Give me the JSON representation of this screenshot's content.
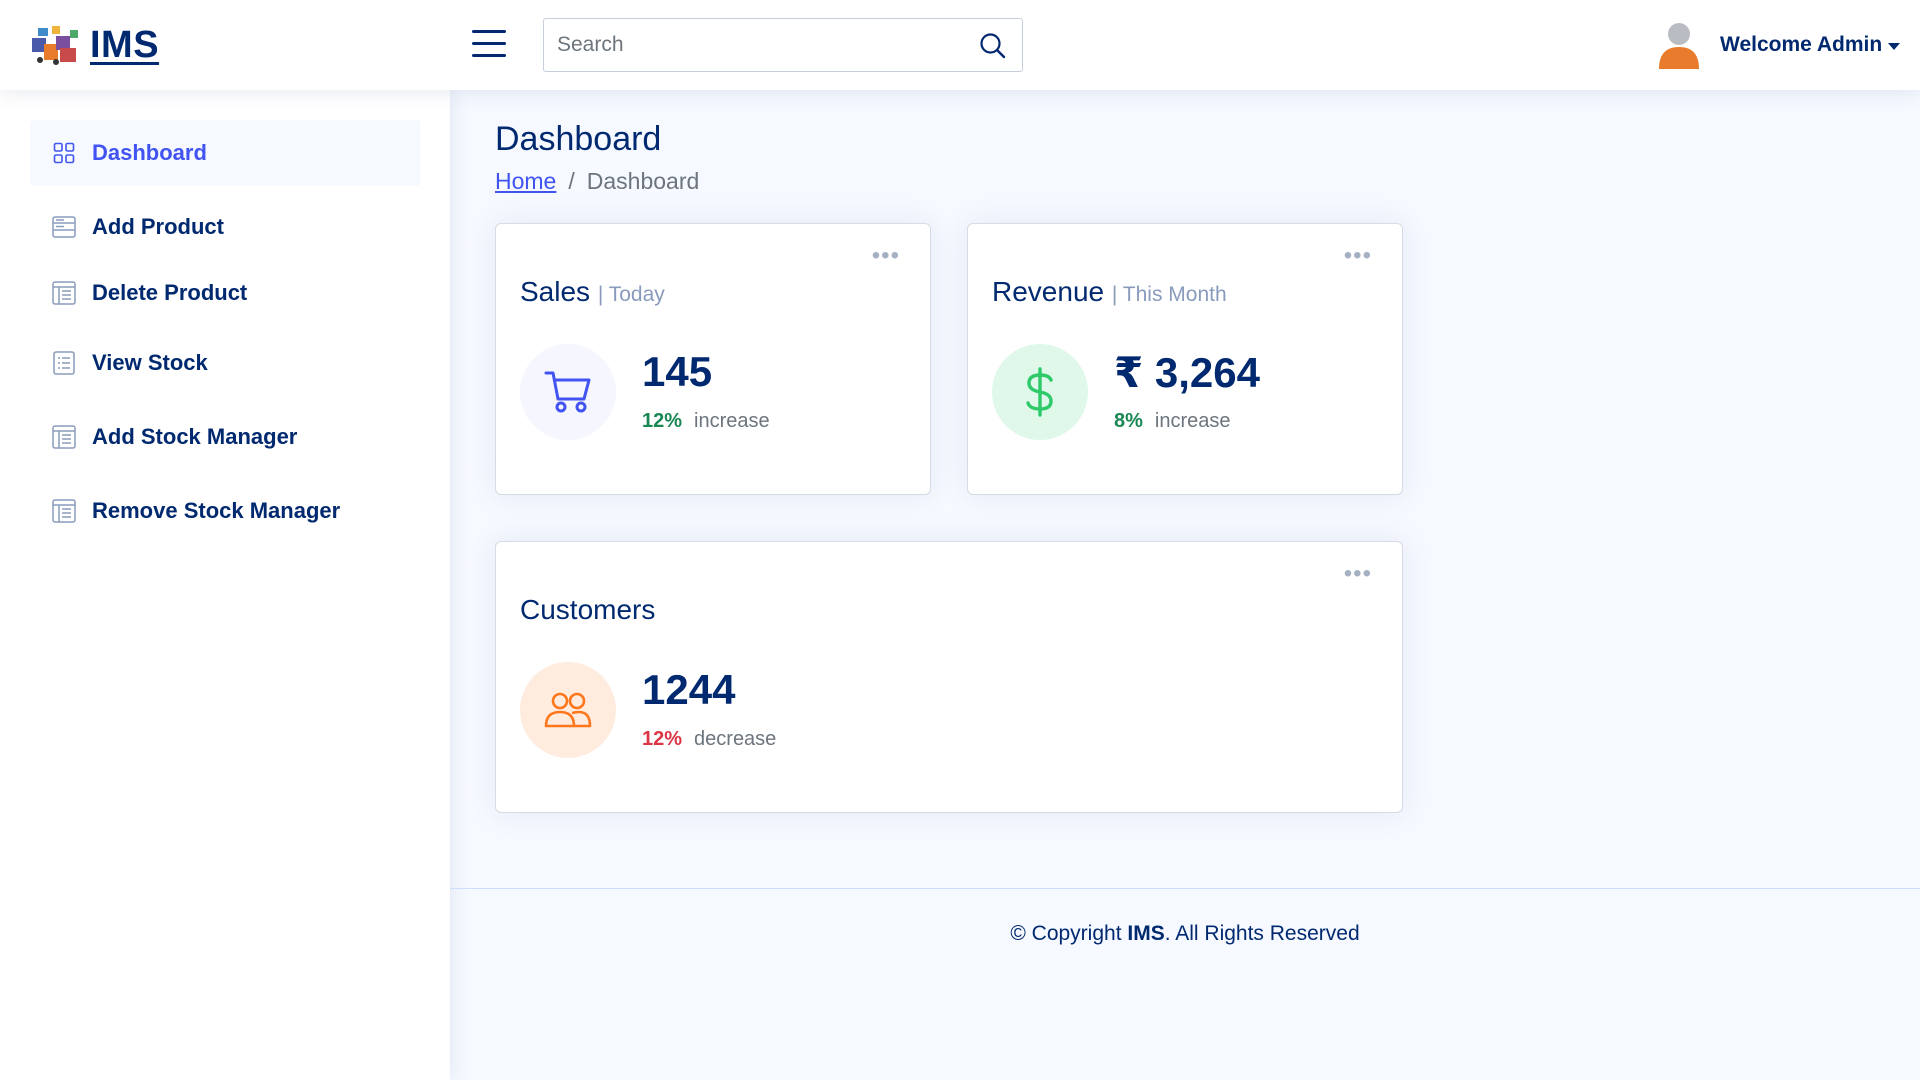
{
  "header": {
    "logo_text": "IMS",
    "search_placeholder": "Search",
    "welcome": "Welcome Admin"
  },
  "sidebar": {
    "items": [
      {
        "label": "Dashboard",
        "icon": "grid-icon",
        "active": true
      },
      {
        "label": "Add Product",
        "icon": "layout-icon"
      },
      {
        "label": "Delete Product",
        "icon": "layout-text-icon"
      },
      {
        "label": "View Stock",
        "icon": "list-icon"
      },
      {
        "label": "Add Stock Manager",
        "icon": "layout-text-icon"
      },
      {
        "label": "Remove Stock Manager",
        "icon": "layout-text-icon"
      }
    ]
  },
  "page": {
    "title": "Dashboard",
    "breadcrumb_home": "Home",
    "breadcrumb_sep": "/",
    "breadcrumb_current": "Dashboard"
  },
  "cards": {
    "sales": {
      "title": "Sales",
      "subtitle": "| Today",
      "value": "145",
      "pct": "12%",
      "change_word": "increase",
      "icon": "cart-icon",
      "pct_color": "#198754"
    },
    "revenue": {
      "title": "Revenue",
      "subtitle": "| This Month",
      "value": "₹ 3,264",
      "pct": "8%",
      "change_word": "increase",
      "icon": "dollar-icon",
      "pct_color": "#198754"
    },
    "customers": {
      "title": "Customers",
      "value": "1244",
      "pct": "12%",
      "change_word": "decrease",
      "icon": "people-icon",
      "pct_color": "#dc3545"
    },
    "menu_dots": "•••"
  },
  "footer": {
    "prefix": "© Copyright",
    "brand": "IMS",
    "suffix": ". All Rights Reserved"
  },
  "colors": {
    "primary": "#4154f1",
    "navy": "#012970",
    "success": "#198754",
    "danger": "#dc3545"
  }
}
